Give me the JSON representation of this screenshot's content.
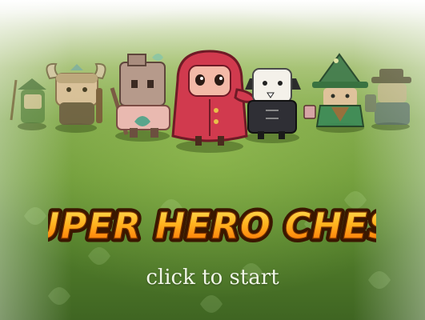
{
  "game": {
    "title": "SUPER HERO CHESS",
    "prompt": "click to start"
  },
  "cast": [
    {
      "character": "green-archer",
      "icon": "archer-character-icon"
    },
    {
      "character": "horned-viking",
      "icon": "viking-character-icon"
    },
    {
      "character": "wooden-golem",
      "icon": "golem-character-icon"
    },
    {
      "character": "red-riding-hood",
      "icon": "red-hood-character-icon"
    },
    {
      "character": "vampire-count",
      "icon": "vampire-character-icon"
    },
    {
      "character": "green-wizard",
      "icon": "wizard-character-icon"
    },
    {
      "character": "cowboy",
      "icon": "cowboy-character-icon"
    }
  ],
  "colors": {
    "title_fill_top": "#ffd23a",
    "title_fill_bottom": "#ff6a00",
    "title_outline": "#3a1700",
    "grass_light": "#a9c27c",
    "grass_dark": "#3f6522",
    "hood_red": "#d13a4e",
    "prompt_text": "#f1f6e8"
  }
}
